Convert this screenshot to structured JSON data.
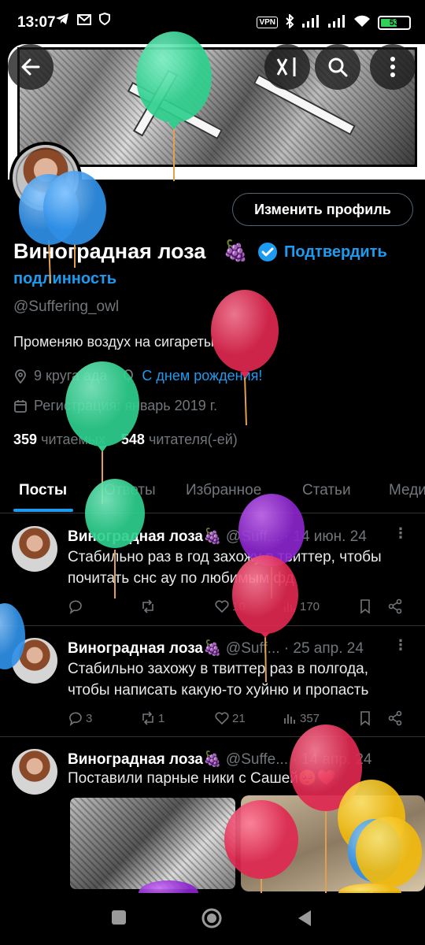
{
  "status_bar": {
    "time": "13:07",
    "vpn_label": "VPN",
    "battery_level": "53"
  },
  "profile": {
    "edit_button": "Изменить профиль",
    "name": "Виноградная лоза",
    "name_emoji": "🍇",
    "verify_link_part1": "Подтвердить",
    "verify_link_part2": "подлинность",
    "handle": "@Suffering_owl",
    "bio": "Променяю воздух на сигареты",
    "location": "9 круга ада",
    "birthday": "С днем рождения!",
    "joined": "Регистрация: январь 2019 г.",
    "following_count": "359",
    "following_label": "читаемых",
    "followers_count": "548",
    "followers_label": "читателя(-ей)"
  },
  "tabs": [
    "Посты",
    "Ответы",
    "Избранное",
    "Статьи",
    "Медиа"
  ],
  "posts": [
    {
      "author": "Виноградная лоза🍇",
      "handle": "@Suff...",
      "date": "· 14 июн. 24",
      "line1": "Стабильно раз в год захожу в твиттер, чтобы",
      "line2": "почитать снс ау по любимым фд",
      "replies": "",
      "reposts": "",
      "likes": "10",
      "views": "170"
    },
    {
      "author": "Виноградная лоза🍇",
      "handle": "@Suff...",
      "date": "· 25 апр. 24",
      "line1": "Стабильно захожу в твиттер раз в полгода,",
      "line2": "чтобы написать какую-то хуйню и пропасть",
      "replies": "3",
      "reposts": "1",
      "likes": "21",
      "views": "357"
    },
    {
      "author": "Виноградная лоза🍇",
      "handle": "@Suffe...",
      "date": "· 14 апр. 24",
      "line1": "Поставили парные ники с Сашей🥺❤️",
      "line2": ""
    }
  ],
  "colors": {
    "accent": "#1d9bf0",
    "balloon_green": "#34d399",
    "balloon_blue": "#3b9df0",
    "balloon_red": "#e8325a",
    "balloon_purple": "#9b34d8",
    "balloon_yellow": "#f5c518"
  }
}
